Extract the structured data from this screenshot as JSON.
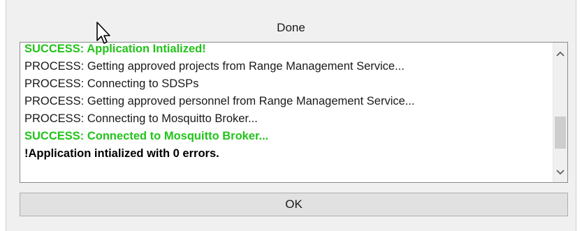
{
  "dialog": {
    "title": "Done",
    "log": [
      {
        "text": "SUCCESS: Application Intialized!",
        "kind": "success"
      },
      {
        "text": "PROCESS: Getting approved projects from Range Management Service...",
        "kind": "normal"
      },
      {
        "text": "PROCESS: Connecting to SDSPs",
        "kind": "normal"
      },
      {
        "text": "PROCESS: Getting approved personnel from Range Management Service...",
        "kind": "normal"
      },
      {
        "text": "PROCESS: Connecting to Mosquitto Broker...",
        "kind": "normal"
      },
      {
        "text": "SUCCESS: Connected to Mosquitto Broker...",
        "kind": "success"
      },
      {
        "text": "!Application intialized with 0 errors.",
        "kind": "bold"
      },
      {
        "text": "",
        "kind": "partial"
      }
    ],
    "scroll_up_icon": "chevron-up-icon",
    "scroll_down_icon": "chevron-down-icon",
    "ok_label": "OK",
    "success_color": "#22c41a"
  }
}
